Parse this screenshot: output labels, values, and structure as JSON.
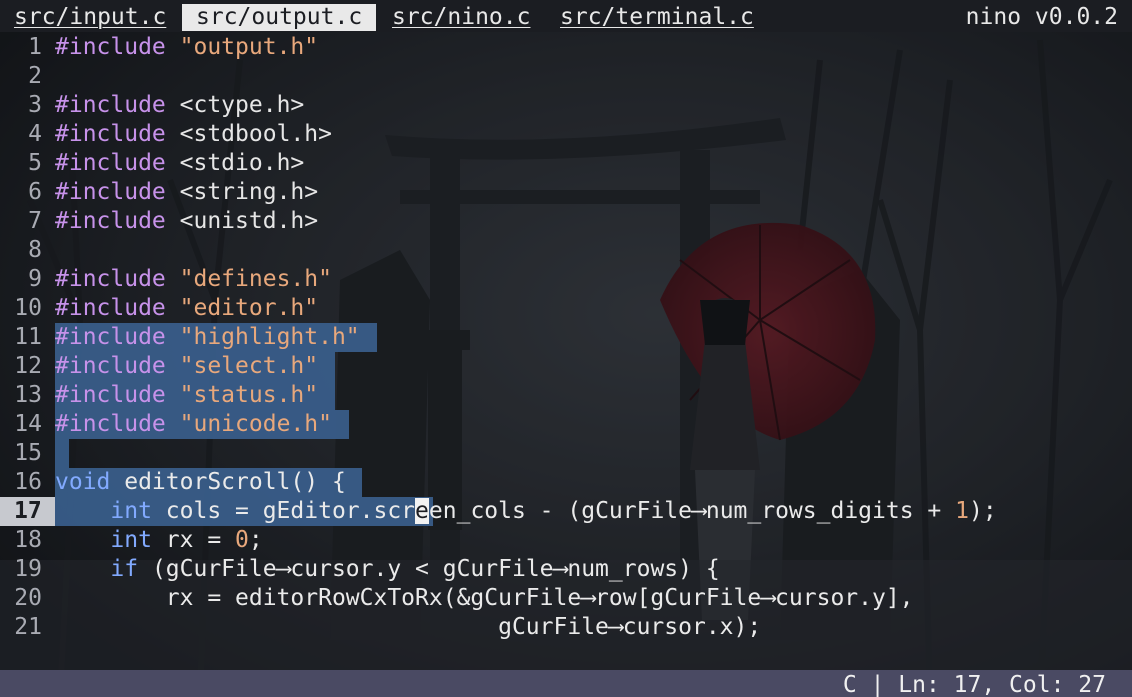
{
  "tabs": [
    {
      "label": "src/input.c",
      "active": false
    },
    {
      "label": "src/output.c",
      "active": true
    },
    {
      "label": "src/nino.c",
      "active": false
    },
    {
      "label": "src/terminal.c",
      "active": false
    }
  ],
  "app_version": "nino v0.0.2",
  "editor": {
    "current_line": 17,
    "lines": [
      {
        "n": "1",
        "parts": [
          [
            "kw-inc",
            "#include"
          ],
          [
            "txt",
            " "
          ],
          [
            "str",
            "\"output.h\""
          ]
        ]
      },
      {
        "n": "2",
        "parts": []
      },
      {
        "n": "3",
        "parts": [
          [
            "kw-inc",
            "#include"
          ],
          [
            "txt",
            " "
          ],
          [
            "ang",
            "<ctype.h>"
          ]
        ]
      },
      {
        "n": "4",
        "parts": [
          [
            "kw-inc",
            "#include"
          ],
          [
            "txt",
            " "
          ],
          [
            "ang",
            "<stdbool.h>"
          ]
        ]
      },
      {
        "n": "5",
        "parts": [
          [
            "kw-inc",
            "#include"
          ],
          [
            "txt",
            " "
          ],
          [
            "ang",
            "<stdio.h>"
          ]
        ]
      },
      {
        "n": "6",
        "parts": [
          [
            "kw-inc",
            "#include"
          ],
          [
            "txt",
            " "
          ],
          [
            "ang",
            "<string.h>"
          ]
        ]
      },
      {
        "n": "7",
        "parts": [
          [
            "kw-inc",
            "#include"
          ],
          [
            "txt",
            " "
          ],
          [
            "ang",
            "<unistd.h>"
          ]
        ]
      },
      {
        "n": "8",
        "parts": []
      },
      {
        "n": "9",
        "parts": [
          [
            "kw-inc",
            "#include"
          ],
          [
            "txt",
            " "
          ],
          [
            "str",
            "\"defines.h\""
          ]
        ]
      },
      {
        "n": "10",
        "parts": [
          [
            "kw-inc",
            "#include"
          ],
          [
            "txt",
            " "
          ],
          [
            "str",
            "\"editor.h\""
          ]
        ]
      },
      {
        "n": "11",
        "parts": [
          [
            "kw-inc",
            "#include"
          ],
          [
            "txt",
            " "
          ],
          [
            "str",
            "\"highlight.h\""
          ]
        ]
      },
      {
        "n": "12",
        "parts": [
          [
            "kw-inc",
            "#include"
          ],
          [
            "txt",
            " "
          ],
          [
            "str",
            "\"select.h\""
          ]
        ]
      },
      {
        "n": "13",
        "parts": [
          [
            "kw-inc",
            "#include"
          ],
          [
            "txt",
            " "
          ],
          [
            "str",
            "\"status.h\""
          ]
        ]
      },
      {
        "n": "14",
        "parts": [
          [
            "kw-inc",
            "#include"
          ],
          [
            "txt",
            " "
          ],
          [
            "str",
            "\"unicode.h\""
          ]
        ]
      },
      {
        "n": "15",
        "parts": []
      },
      {
        "n": "16",
        "parts": [
          [
            "kw",
            "void"
          ],
          [
            "txt",
            " editorScroll() {"
          ]
        ]
      },
      {
        "n": "17",
        "parts": [
          [
            "txt",
            "    "
          ],
          [
            "kw",
            "int"
          ],
          [
            "txt",
            " cols = gEditor.scr"
          ],
          [
            "cursor",
            "e"
          ],
          [
            "txt",
            "en_cols - (gCurFile⟶num_rows_digits + "
          ],
          [
            "num",
            "1"
          ],
          [
            "txt",
            ");"
          ]
        ]
      },
      {
        "n": "18",
        "parts": [
          [
            "txt",
            "    "
          ],
          [
            "kw",
            "int"
          ],
          [
            "txt",
            " rx = "
          ],
          [
            "num",
            "0"
          ],
          [
            "txt",
            ";"
          ]
        ]
      },
      {
        "n": "19",
        "parts": [
          [
            "txt",
            "    "
          ],
          [
            "kw",
            "if"
          ],
          [
            "txt",
            " (gCurFile⟶cursor.y < gCurFile⟶num_rows) {"
          ]
        ]
      },
      {
        "n": "20",
        "parts": [
          [
            "txt",
            "        rx = editorRowCxToRx(&gCurFile⟶row[gCurFile⟶cursor.y],"
          ]
        ]
      },
      {
        "n": "21",
        "parts": [
          [
            "txt",
            "                                gCurFile⟶cursor.x);"
          ]
        ]
      }
    ]
  },
  "status": {
    "text": "C | Ln: 17, Col: 27"
  },
  "colors": {
    "selection": "#3a5e8c",
    "status_bar": "#4a4a63",
    "include_keyword": "#c792ea",
    "type_keyword": "#82aaff",
    "string": "#e8a87c"
  }
}
